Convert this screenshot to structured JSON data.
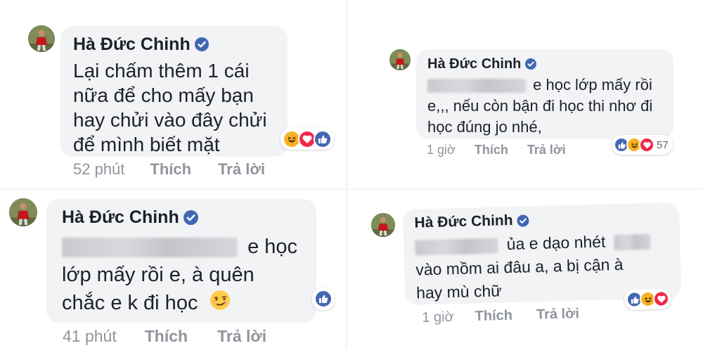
{
  "colors": {
    "bubble_bg": "#f2f3f5",
    "name_text": "#1d2129",
    "meta_text": "#90949c",
    "verified_blue": "#4267b2",
    "like_blue": "#4267b2",
    "love_red": "#f0284a",
    "haha_yellow": "#f7b125"
  },
  "comments": [
    {
      "author": "Hà Đức Chinh",
      "verified": true,
      "lines": [
        "Lại chấm thêm 1 cái",
        "nữa để cho mấy bạn",
        "hay chửi vào đây chửi",
        "để mình biết mặt"
      ],
      "reactions": [
        "haha-icon",
        "love-icon",
        "like-icon"
      ],
      "time": "52 phút",
      "like_label": "Thích",
      "reply_label": "Trả lời"
    },
    {
      "author": "Hà Đức Chinh",
      "verified": true,
      "line1_after": "e học lớp mấy rồi",
      "lines": [
        "e,,, nếu còn bận đi học thi nhơ đi",
        "học đúng jo nhé,"
      ],
      "reactions": [
        "like-icon",
        "haha-icon",
        "love-icon"
      ],
      "reaction_count": "57",
      "time": "1 giờ",
      "like_label": "Thích",
      "reply_label": "Trả lời"
    },
    {
      "author": "Hà Đức Chinh",
      "verified": true,
      "line1_after": "e học",
      "lines": [
        "lớp mấy rồi e, à quên",
        "chắc e k đi học"
      ],
      "reactions": [
        "like-icon"
      ],
      "time": "41 phút",
      "like_label": "Thích",
      "reply_label": "Trả lời"
    },
    {
      "author": "Hà Đức Chinh",
      "verified": true,
      "line1_after": "ủa e dạo nhét",
      "lines": [
        "vào mồm ai đâu a, a bị cận à",
        "hay mù chữ"
      ],
      "reactions": [
        "like-icon",
        "haha-icon",
        "love-icon"
      ],
      "time": "1 giờ",
      "like_label": "Thích",
      "reply_label": "Trả lời"
    }
  ]
}
